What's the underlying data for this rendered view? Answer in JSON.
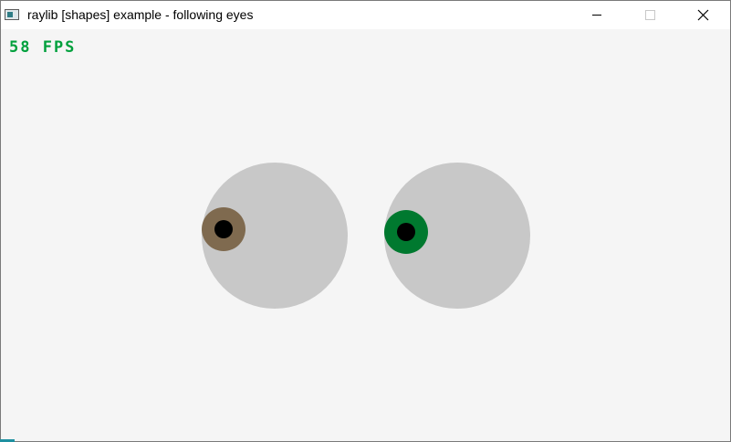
{
  "window": {
    "title": "raylib [shapes] example - following eyes"
  },
  "controls": {
    "minimize_icon": "minimize-icon",
    "maximize_icon": "maximize-icon",
    "close_icon": "close-icon"
  },
  "canvas": {
    "fps_text": "58 FPS",
    "background_color": "#f5f5f5",
    "sclera_color": "#c8c8c8",
    "left_iris_color": "#7f6a4f",
    "right_iris_color": "#00792f",
    "pupil_color": "#000000"
  }
}
